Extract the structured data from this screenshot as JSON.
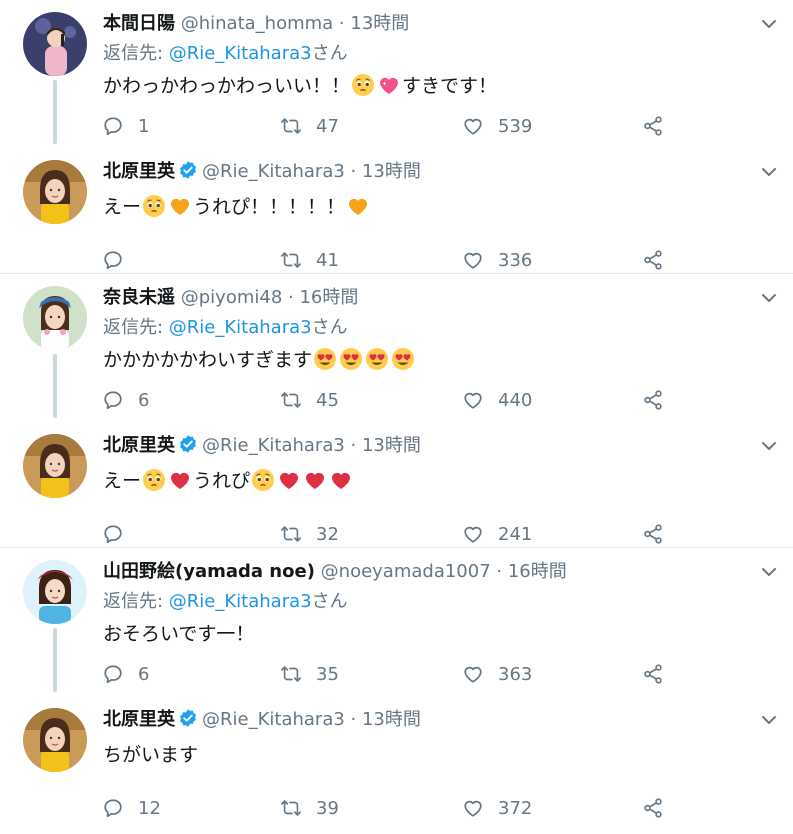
{
  "reply_prefix": "返信先: ",
  "reply_suffix": "さん",
  "colors": {
    "name": "#14171a",
    "meta": "#657786",
    "link": "#1b95e0",
    "verified": "#1da1f2"
  },
  "threads": [
    {
      "reply": {
        "name": "本間日陽",
        "handle": "@hinata_homma",
        "dot": "·",
        "time": "13時間",
        "reply_to": "@Rie_Kitahara3",
        "text_parts": [
          "かわっかわっかわっいい！！",
          "emoji:pleading",
          "emoji:sparkling-heart",
          "すきです！"
        ],
        "counts": {
          "replies": "1",
          "retweets": "47",
          "likes": "539"
        }
      },
      "answer": {
        "name": "北原里英",
        "handle": "@Rie_Kitahara3",
        "dot": "·",
        "time": "13時間",
        "text_parts": [
          "えー",
          "emoji:pleading",
          "emoji:orange-heart",
          "うれぴ！！！！！",
          "emoji:orange-heart"
        ],
        "counts": {
          "replies": "",
          "retweets": "41",
          "likes": "336"
        }
      }
    },
    {
      "reply": {
        "name": "奈良未遥",
        "handle": "@piyomi48",
        "dot": "·",
        "time": "16時間",
        "reply_to": "@Rie_Kitahara3",
        "text_parts": [
          "かかかかかわいすぎます",
          "emoji:heart-eyes",
          "emoji:heart-eyes",
          "emoji:heart-eyes",
          "emoji:heart-eyes"
        ],
        "counts": {
          "replies": "6",
          "retweets": "45",
          "likes": "440"
        }
      },
      "answer": {
        "name": "北原里英",
        "handle": "@Rie_Kitahara3",
        "dot": "·",
        "time": "13時間",
        "text_parts": [
          "えー",
          "emoji:pleading",
          "emoji:red-heart",
          "うれぴ",
          "emoji:pleading",
          "emoji:red-heart",
          "emoji:red-heart",
          "emoji:red-heart"
        ],
        "counts": {
          "replies": "",
          "retweets": "32",
          "likes": "241"
        }
      }
    },
    {
      "reply": {
        "name": "山田野絵(yamada noe)",
        "handle": "@noeyamada1007",
        "dot": "·",
        "time": "16時間",
        "reply_to": "@Rie_Kitahara3",
        "text_parts": [
          "おそろいです一！"
        ],
        "counts": {
          "replies": "6",
          "retweets": "35",
          "likes": "363"
        }
      },
      "answer": {
        "name": "北原里英",
        "handle": "@Rie_Kitahara3",
        "dot": "·",
        "time": "13時間",
        "text_parts": [
          "ちがいます"
        ],
        "counts": {
          "replies": "12",
          "retweets": "39",
          "likes": "372"
        }
      }
    }
  ]
}
